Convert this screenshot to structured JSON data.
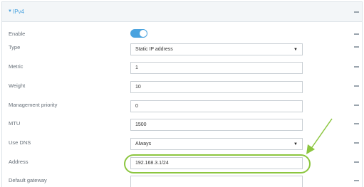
{
  "section": {
    "title": "IPv4",
    "caret_icon": "triangle-down-icon"
  },
  "fields": {
    "enable": {
      "label": "Enable",
      "value": true
    },
    "type": {
      "label": "Type",
      "value": "Static IP address"
    },
    "metric": {
      "label": "Metric",
      "value": "1"
    },
    "weight": {
      "label": "Weight",
      "value": "10"
    },
    "management_priority": {
      "label": "Management priority",
      "value": "0"
    },
    "mtu": {
      "label": "MTU",
      "value": "1500"
    },
    "use_dns": {
      "label": "Use DNS",
      "value": "Always"
    },
    "address": {
      "label": "Address",
      "value": "192.168.3.1/24"
    },
    "default_gateway": {
      "label": "Default gateway",
      "value": ""
    }
  },
  "colors": {
    "accent": "#4aa3df",
    "highlight": "#8cc63f"
  }
}
